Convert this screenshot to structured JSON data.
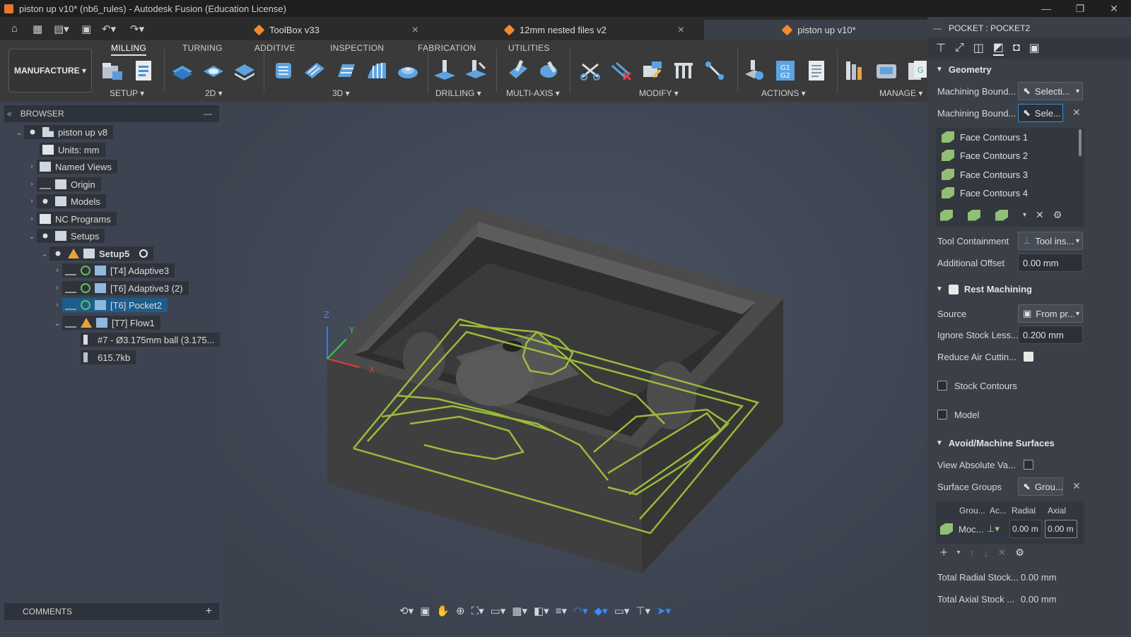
{
  "window": {
    "title": "piston up v10* (nb6_rules) - Autodesk Fusion (Education License)"
  },
  "doc_tabs": [
    {
      "label": "ToolBox v33"
    },
    {
      "label": "12mm nested files v2"
    },
    {
      "label": "piston up v10*"
    }
  ],
  "workspace": {
    "label": "MANUFACTURE"
  },
  "toolbar_tabs": [
    "MILLING",
    "TURNING",
    "ADDITIVE",
    "INSPECTION",
    "FABRICATION",
    "UTILITIES"
  ],
  "groups": {
    "setup": "SETUP",
    "twod": "2D",
    "threed": "3D",
    "drilling": "DRILLING",
    "multiaxis": "MULTI-AXIS",
    "modify": "MODIFY",
    "actions": "ACTIONS",
    "manage": "MANAGE"
  },
  "browser": {
    "title": "BROWSER",
    "root": "piston up v8",
    "units": "Units: mm",
    "named_views": "Named Views",
    "origin": "Origin",
    "models": "Models",
    "nc_programs": "NC Programs",
    "setups": "Setups",
    "setup5": "Setup5",
    "ops": [
      "[T4] Adaptive3",
      "[T6] Adaptive3 (2)",
      "[T6] Pocket2",
      "[T7] Flow1"
    ],
    "tool": "#7 - Ø3.175mm ball (3.175...",
    "size": "615.7kb"
  },
  "comments": {
    "title": "COMMENTS"
  },
  "axes": {
    "z": "Z",
    "y": "Y",
    "x": "X"
  },
  "panel": {
    "title": "POCKET : POCKET2",
    "geometry": "Geometry",
    "mb1_label": "Machining Bound...",
    "mb1_value": "Selecti...",
    "mb2_label": "Machining Bound...",
    "mb2_value": "Sele...",
    "contours": [
      "Face Contours 1",
      "Face Contours 2",
      "Face Contours 3",
      "Face Contours 4"
    ],
    "tool_containment_label": "Tool Containment",
    "tool_containment_value": "Tool ins...",
    "additional_offset_label": "Additional Offset",
    "additional_offset_value": "0.00 mm",
    "rest_machining": "Rest Machining",
    "source_label": "Source",
    "source_value": "From pr...",
    "ignore_label": "Ignore Stock Less...",
    "ignore_value": "0.200 mm",
    "reduce_label": "Reduce Air Cuttin...",
    "stock_contours": "Stock Contours",
    "model": "Model",
    "avoid": "Avoid/Machine Surfaces",
    "view_abs_label": "View Absolute Va...",
    "surface_groups_label": "Surface Groups",
    "surface_groups_value": "Grou...",
    "table_headers": [
      "Grou...",
      "Ac...",
      "Radial",
      "Axial"
    ],
    "table_row": {
      "group": "Moc...",
      "radial": "0.00 m",
      "axial": "0.00 m"
    },
    "total_radial_label": "Total Radial Stock...",
    "total_radial_value": "0.00 mm",
    "total_axial_label": "Total Axial Stock ...",
    "total_axial_value": "0.00 mm"
  }
}
